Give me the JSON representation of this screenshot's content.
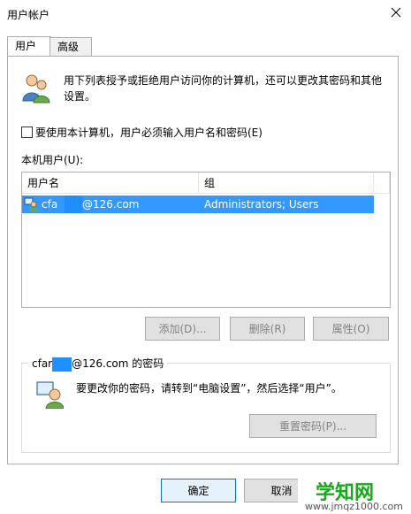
{
  "window": {
    "title": "用户帐户"
  },
  "tabs": [
    {
      "label": "用户"
    },
    {
      "label": "高级"
    }
  ],
  "intro_text_line1": "用下列表授予或拒绝用户访问你的计算机，还可以更改其密码和其他",
  "intro_text_line2": "设置。",
  "require_login_checkbox": {
    "label": "要使用本计算机，用户必须输入用户名和密码(E)",
    "checked": false
  },
  "local_users_label": "本机用户(U):",
  "table": {
    "columns": [
      "用户名",
      "组"
    ],
    "rows": [
      {
        "user_prefix": "cfa",
        "user_suffix": "@126.com",
        "group": "Administrators; Users"
      }
    ]
  },
  "user_buttons": {
    "add": "添加(D)...",
    "remove": "删除(R)",
    "properties": "属性(O)"
  },
  "password_group": {
    "title_prefix": "cfar",
    "title_suffix": "@126.com 的密码",
    "text": "要更改你的密码，请转到“电脑设置”，然后选择“用户”。",
    "reset_button": "重置密码(P)..."
  },
  "footer_buttons": {
    "ok": "确定",
    "cancel": "取消"
  },
  "watermark": {
    "text": "学知网",
    "url": "www.jmqz1000.com"
  },
  "colors": {
    "selection": "#3399ff",
    "watermark_green": "#19a81b",
    "watermark_text": "#555555"
  }
}
